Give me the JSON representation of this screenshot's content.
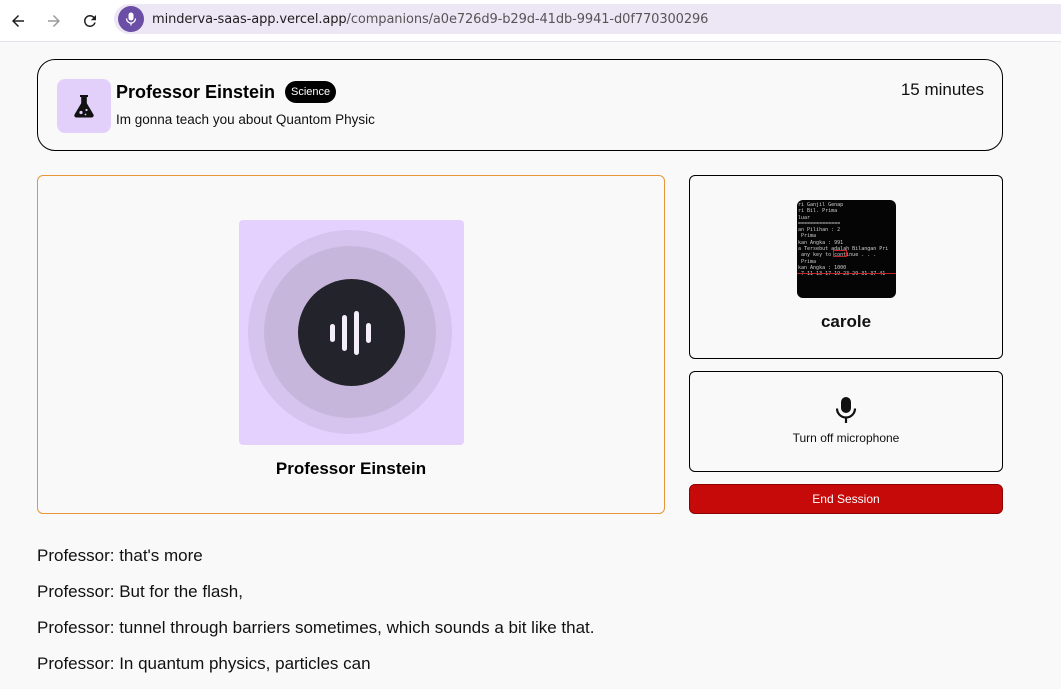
{
  "browser": {
    "url_host": "minderva-saas-app.vercel.app",
    "url_path": "/companions/a0e726d9-b29d-41db-9941-d0f770300296"
  },
  "header": {
    "name": "Professor Einstein",
    "subject": "Science",
    "topic": "Im gonna teach you about Quantom Physic",
    "duration": "15 minutes",
    "icon": "flask-icon"
  },
  "companion": {
    "name": "Professor Einstein",
    "icon": "soundwave-icon",
    "colors": {
      "panel_border": "#e7953a",
      "avatar_bg": "#e4d1fd"
    }
  },
  "user": {
    "name": "carole",
    "avatar_lines": [
      "ri Ganjil Genap",
      "ri Bil. Prima",
      "luar",
      "==============",
      "",
      "an Pilihan : 2",
      "",
      " Prima",
      "kan Angka : 991",
      "a Tersebut adalah Bilangan Pri",
      " any key to continue . . .",
      "",
      " Prima",
      "kan Angka : 1000",
      " 7 11 13 17 19 23 29 31 37 41"
    ]
  },
  "controls": {
    "mic_label": "Turn off microphone",
    "mic_icon": "microphone-icon",
    "end_label": "End Session",
    "end_color": "#c60a0a"
  },
  "transcript": [
    "Professor: that's more",
    "Professor: But for the flash,",
    "Professor: tunnel through barriers sometimes, which sounds a bit like that.",
    "Professor: In quantum physics, particles can"
  ]
}
